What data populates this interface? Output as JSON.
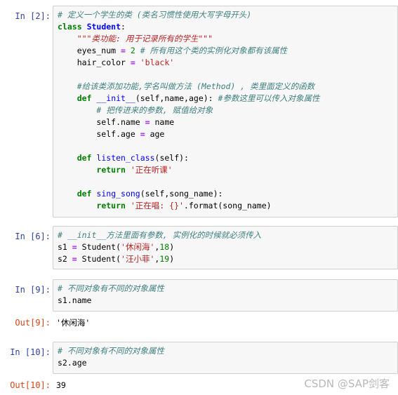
{
  "cells": [
    {
      "prompt": "In  [2]:",
      "lines": [
        [
          [
            "c",
            "# 定义一个学生的类 (类名习惯性使用大写字母开头)"
          ]
        ],
        [
          [
            "k",
            "class"
          ],
          [
            "",
            " "
          ],
          [
            "nc",
            "Student"
          ],
          [
            "",
            ":"
          ]
        ],
        [
          [
            "",
            "    "
          ],
          [
            "sd",
            "\"\"\"类功能: 用于记录所有的学生\"\"\""
          ]
        ],
        [
          [
            "",
            "    eyes_num "
          ],
          [
            "o",
            "="
          ],
          [
            "",
            " "
          ],
          [
            "m",
            "2"
          ],
          [
            "",
            " "
          ],
          [
            "c",
            "# 所有用这个类的实例化对象都有该属性"
          ]
        ],
        [
          [
            "",
            "    hair_color "
          ],
          [
            "o",
            "="
          ],
          [
            "",
            " "
          ],
          [
            "s",
            "'black'"
          ]
        ],
        [
          [
            "",
            ""
          ]
        ],
        [
          [
            "",
            "    "
          ],
          [
            "c",
            "#给该类添加功能,学名叫做方法 (Method) , 类里面定义的函数"
          ]
        ],
        [
          [
            "",
            "    "
          ],
          [
            "k",
            "def"
          ],
          [
            "",
            " "
          ],
          [
            "nf",
            "__init__"
          ],
          [
            "",
            "(self,name,age): "
          ],
          [
            "c",
            "#参数这里可以传入对象属性"
          ]
        ],
        [
          [
            "",
            "        "
          ],
          [
            "c",
            "# 把传进来的参数, 赋值给对象"
          ]
        ],
        [
          [
            "",
            "        self.name "
          ],
          [
            "o",
            "="
          ],
          [
            "",
            " name"
          ]
        ],
        [
          [
            "",
            "        self.age "
          ],
          [
            "o",
            "="
          ],
          [
            "",
            " age"
          ]
        ],
        [
          [
            "",
            ""
          ]
        ],
        [
          [
            "",
            "    "
          ],
          [
            "k",
            "def"
          ],
          [
            "",
            " "
          ],
          [
            "nf",
            "listen_class"
          ],
          [
            "",
            "(self):"
          ]
        ],
        [
          [
            "",
            "        "
          ],
          [
            "k",
            "return"
          ],
          [
            "",
            " "
          ],
          [
            "s",
            "'正在听课'"
          ]
        ],
        [
          [
            "",
            ""
          ]
        ],
        [
          [
            "",
            "    "
          ],
          [
            "k",
            "def"
          ],
          [
            "",
            " "
          ],
          [
            "nf",
            "sing_song"
          ],
          [
            "",
            "(self,song_name):"
          ]
        ],
        [
          [
            "",
            "        "
          ],
          [
            "k",
            "return"
          ],
          [
            "",
            " "
          ],
          [
            "s",
            "'正在唱: {}'"
          ],
          [
            "",
            ".format(song_name)"
          ]
        ]
      ]
    },
    {
      "prompt": "In  [6]:",
      "lines": [
        [
          [
            "c",
            "# __init__方法里面有参数, 实例化的时候就必须传入"
          ]
        ],
        [
          [
            "",
            "s1 "
          ],
          [
            "o",
            "="
          ],
          [
            "",
            " Student("
          ],
          [
            "s",
            "'休闲海'"
          ],
          [
            "",
            ","
          ],
          [
            "m",
            "18"
          ],
          [
            "",
            ")"
          ]
        ],
        [
          [
            "",
            "s2 "
          ],
          [
            "o",
            "="
          ],
          [
            "",
            " Student("
          ],
          [
            "s",
            "'汪小菲'"
          ],
          [
            "",
            ","
          ],
          [
            "m",
            "19"
          ],
          [
            "",
            ")"
          ]
        ]
      ]
    },
    {
      "prompt": "In  [9]:",
      "lines": [
        [
          [
            "c",
            "# 不同对象有不同的对象属性"
          ]
        ],
        [
          [
            "",
            "s1.name"
          ]
        ]
      ],
      "out_prompt": "Out[9]:",
      "output": "'休闲海'"
    },
    {
      "prompt": "In  [10]:",
      "lines": [
        [
          [
            "c",
            "# 不同对象有不同的对象属性"
          ]
        ],
        [
          [
            "",
            "s2.age"
          ]
        ]
      ],
      "out_prompt": "Out[10]:",
      "output": "39"
    }
  ],
  "watermark": "CSDN @SAP剑客"
}
